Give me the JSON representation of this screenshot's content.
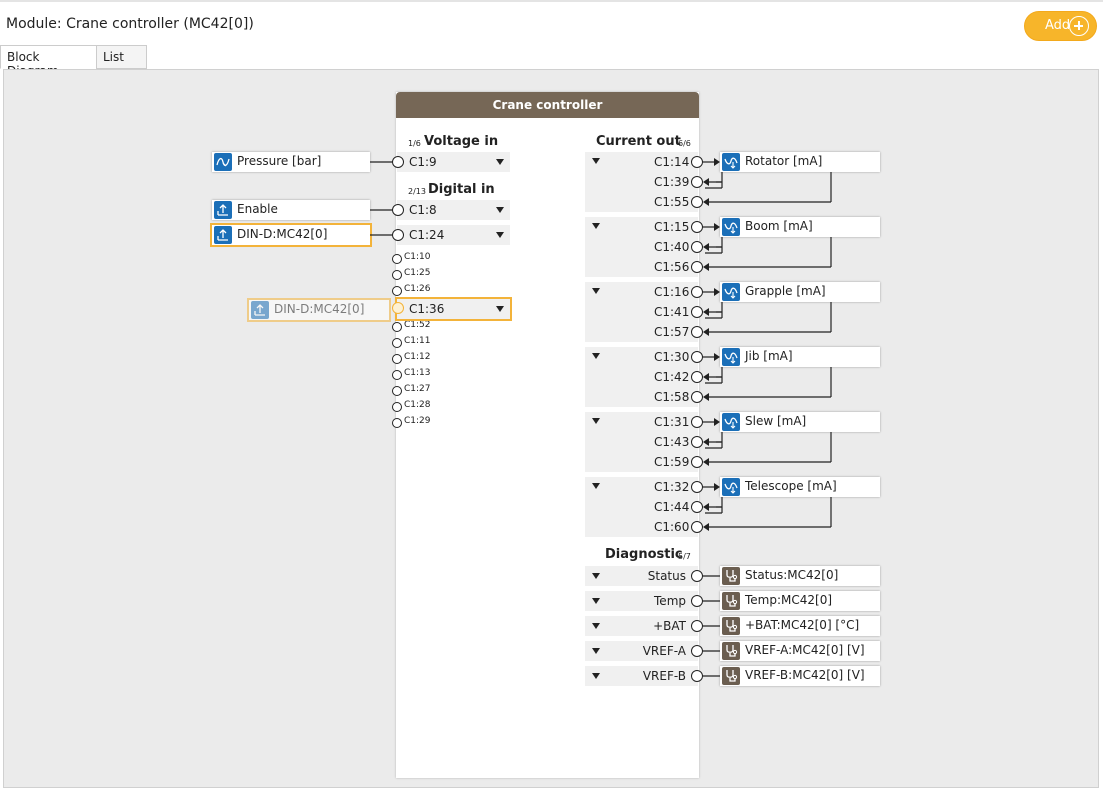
{
  "header": {
    "title": "Module: Crane controller (MC42[0])",
    "add_label": "Add"
  },
  "tabs": [
    "Block Diagram",
    "List"
  ],
  "module": {
    "title": "Crane controller"
  },
  "voltage_in": {
    "count": "1/6",
    "title": "Voltage in",
    "pin": "C1:9",
    "block": "Pressure [bar]"
  },
  "digital_in": {
    "count": "2/13",
    "title": "Digital in",
    "pins": [
      {
        "pin": "C1:8",
        "block": "Enable"
      },
      {
        "pin": "C1:24",
        "block": "DIN-D:MC42[0]"
      }
    ],
    "free_pins": [
      "C1:10",
      "C1:25",
      "C1:26",
      "C1:52",
      "C1:11",
      "C1:12",
      "C1:13",
      "C1:27",
      "C1:28",
      "C1:29"
    ],
    "drag_pin": "C1:36",
    "drag_block": "DIN-D:MC42[0]"
  },
  "current_out": {
    "title": "Current out",
    "count": "6/6",
    "groups": [
      {
        "pins": [
          "C1:14",
          "C1:39",
          "C1:55"
        ],
        "block": "Rotator [mA]"
      },
      {
        "pins": [
          "C1:15",
          "C1:40",
          "C1:56"
        ],
        "block": "Boom [mA]"
      },
      {
        "pins": [
          "C1:16",
          "C1:41",
          "C1:57"
        ],
        "block": "Grapple [mA]"
      },
      {
        "pins": [
          "C1:30",
          "C1:42",
          "C1:58"
        ],
        "block": "Jib [mA]"
      },
      {
        "pins": [
          "C1:31",
          "C1:43",
          "C1:59"
        ],
        "block": "Slew [mA]"
      },
      {
        "pins": [
          "C1:32",
          "C1:44",
          "C1:60"
        ],
        "block": "Telescope [mA]"
      }
    ]
  },
  "diagnostic": {
    "title": "Diagnostic",
    "count": "5/7",
    "items": [
      {
        "pin": "Status",
        "block": "Status:MC42[0]"
      },
      {
        "pin": "Temp",
        "block": "Temp:MC42[0]"
      },
      {
        "pin": "+BAT",
        "block": "+BAT:MC42[0] [°C]"
      },
      {
        "pin": "VREF-A",
        "block": "VREF-A:MC42[0] [V]"
      },
      {
        "pin": "VREF-B",
        "block": "VREF-B:MC42[0] [V]"
      }
    ]
  },
  "colors": {
    "accent": "#f7b52a",
    "module_header": "#766756",
    "block_icon": "#1b6fb8",
    "diag_icon": "#6b5e50"
  }
}
